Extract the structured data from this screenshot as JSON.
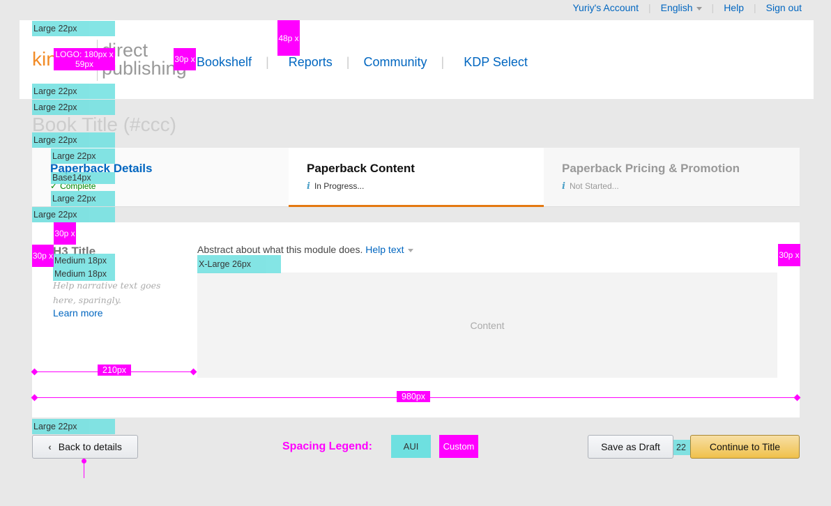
{
  "utility_nav": {
    "account": "Yuriy's Account",
    "language": "English",
    "help": "Help",
    "signout": "Sign out"
  },
  "header": {
    "logo": {
      "kin": "kin",
      "direct": "direct",
      "publishing": "publishing"
    },
    "nav": [
      {
        "label": "Bookshelf"
      },
      {
        "label": "Reports"
      },
      {
        "label": "Community"
      },
      {
        "label": "KDP Select"
      }
    ]
  },
  "book_title": "Book Title (#ccc)",
  "steps": [
    {
      "title": "Paperback Details",
      "status": "Complete",
      "state": "complete"
    },
    {
      "title": "Paperback Content",
      "status": "In Progress...",
      "state": "active"
    },
    {
      "title": "Paperback Pricing & Promotion",
      "status": "Not Started...",
      "state": "not-started"
    }
  ],
  "module": {
    "h3_title": "H3 Title",
    "help_narrative": "Help narrative text goes here, sparingly.",
    "learn_more": "Learn more",
    "abstract": "Abstract about what this module does.",
    "help_text": "Help text",
    "content_label": "Content"
  },
  "annotations": {
    "large": "Large 22px",
    "base": "Base14px",
    "medium": "Medium 18px",
    "xlarge": "X-Large 26px",
    "logo_size": "LOGO: 180px x 59px",
    "px30": "30p x",
    "px48": "48p x",
    "w210": "210px",
    "w980": "980px",
    "gap22": "22"
  },
  "footer": {
    "back": "Back to details",
    "legend_label": "Spacing Legend:",
    "legend_aui": "AUI",
    "legend_custom": "Custom",
    "save_draft": "Save as Draft",
    "continue": "Continue to Title"
  },
  "colors": {
    "link": "#0066c0",
    "accent_orange": "#e47911",
    "success": "#008a00",
    "annotation_aui": "#6ee0e0",
    "annotation_custom": "#ff00ff",
    "primary_button": "#f0c14b"
  }
}
